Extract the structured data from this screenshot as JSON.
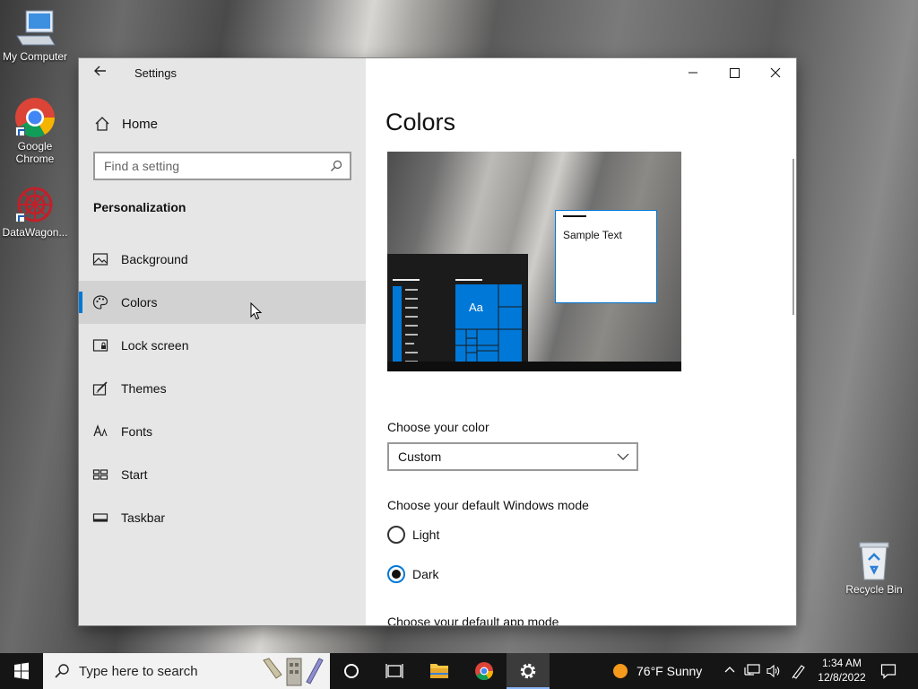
{
  "desktop": {
    "icons": [
      {
        "label": "My Computer"
      },
      {
        "label": "Google Chrome"
      },
      {
        "label": "DataWagon..."
      },
      {
        "label": "Recycle Bin"
      }
    ]
  },
  "window": {
    "title": "Settings",
    "sidebar": {
      "home_label": "Home",
      "search_placeholder": "Find a setting",
      "section_title": "Personalization",
      "items": [
        {
          "label": "Background",
          "icon": "picture-icon"
        },
        {
          "label": "Colors",
          "icon": "palette-icon",
          "selected": true
        },
        {
          "label": "Lock screen",
          "icon": "lock-screen-icon"
        },
        {
          "label": "Themes",
          "icon": "brush-icon"
        },
        {
          "label": "Fonts",
          "icon": "font-icon"
        },
        {
          "label": "Start",
          "icon": "start-tiles-icon"
        },
        {
          "label": "Taskbar",
          "icon": "taskbar-icon"
        }
      ]
    },
    "content": {
      "page_title": "Colors",
      "preview": {
        "sample_text": "Sample Text",
        "tile_label": "Aa"
      },
      "choose_color_label": "Choose your color",
      "choose_color_value": "Custom",
      "windows_mode_label": "Choose your default Windows mode",
      "windows_mode_options": [
        {
          "label": "Light",
          "selected": false
        },
        {
          "label": "Dark",
          "selected": true
        }
      ],
      "app_mode_label": "Choose your default app mode"
    },
    "accent_color": "#0078d7"
  },
  "taskbar": {
    "search_placeholder": "Type here to search",
    "weather": "76°F  Sunny",
    "time": "1:34 AM",
    "date": "12/8/2022"
  }
}
